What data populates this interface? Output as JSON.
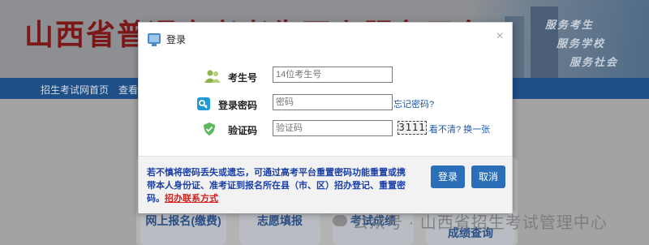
{
  "header": {
    "site_title": "山西省普通高考考生网上服务平台",
    "slogans": [
      "服务考生",
      "服务学校",
      "服务社会"
    ]
  },
  "nav": {
    "items": [
      "招生考试网首页",
      "查看"
    ]
  },
  "tiles": [
    "网上报名(缴费)",
    "志愿填报",
    "考试成绩",
    "成绩查询"
  ],
  "watermark": "公众号 · 山西省招生考试管理中心",
  "modal": {
    "title": "登录",
    "close_icon": "×",
    "fields": {
      "exam_id": {
        "label": "考生号",
        "placeholder": "14位考生号",
        "icon": "users-icon"
      },
      "password": {
        "label": "登录密码",
        "placeholder": "密码",
        "icon": "key-icon",
        "link": "忘记密码?"
      },
      "captcha": {
        "label": "验证码",
        "placeholder": "验证码",
        "icon": "shield-check-icon",
        "image_text": "3111",
        "link": "看不清? 换一张"
      }
    },
    "notice": {
      "text": "若不慎将密码丢失或遗忘，可通过高考平台重置密码功能重置或携带本人身份证、准考证到报名所在县（市、区）招办登记、重置密码。",
      "link": "招办联系方式"
    },
    "buttons": {
      "login": "登录",
      "cancel": "取消"
    }
  },
  "colors": {
    "title_red": "#7d1818",
    "nav_blue": "#1e4f86",
    "button_blue": "#2a6fb8",
    "notice_blue": "#1a3fa6",
    "notice_link_red": "#d62020"
  }
}
